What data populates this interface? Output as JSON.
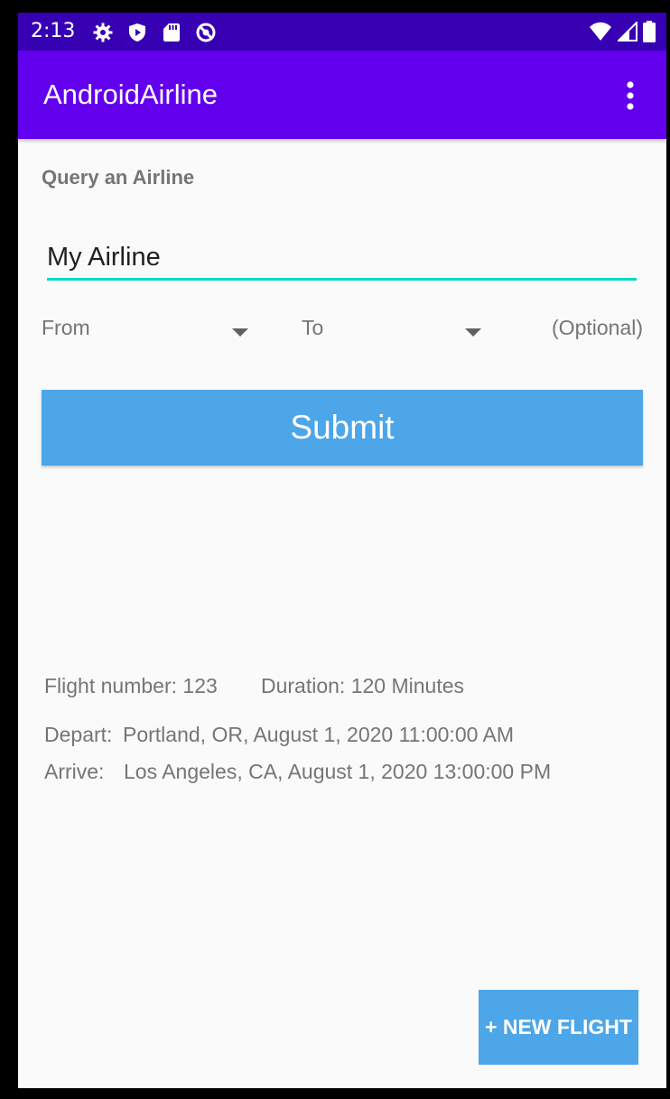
{
  "status_bar": {
    "time": "2:13",
    "left_icons": [
      "gear-icon",
      "shield-icon",
      "sd-card-icon",
      "no-sync-icon"
    ],
    "right_icons": [
      "wifi-icon",
      "cellular-signal-icon",
      "battery-icon"
    ],
    "background": "#3700b3"
  },
  "app_bar": {
    "title": "AndroidAirline",
    "background": "#6200ee",
    "menu_icon": "more-vert-icon"
  },
  "query": {
    "section_label": "Query an Airline",
    "airline_value": "My Airline",
    "accent": "#03dac5",
    "from_label": "From",
    "to_label": "To",
    "optional_label": "(Optional)",
    "submit_label": "Submit",
    "button_color": "#4ca6e8"
  },
  "flight": {
    "number_text": "Flight number: 123",
    "duration_text": "Duration: 120 Minutes",
    "depart_label": "Depart:",
    "depart_value": "Portland, OR, August 1, 2020 11:00:00 AM",
    "arrive_label": "Arrive:",
    "arrive_value": "Los Angeles, CA, August 1, 2020 13:00:00 PM"
  },
  "fab": {
    "label": "+ NEW FLIGHT"
  }
}
